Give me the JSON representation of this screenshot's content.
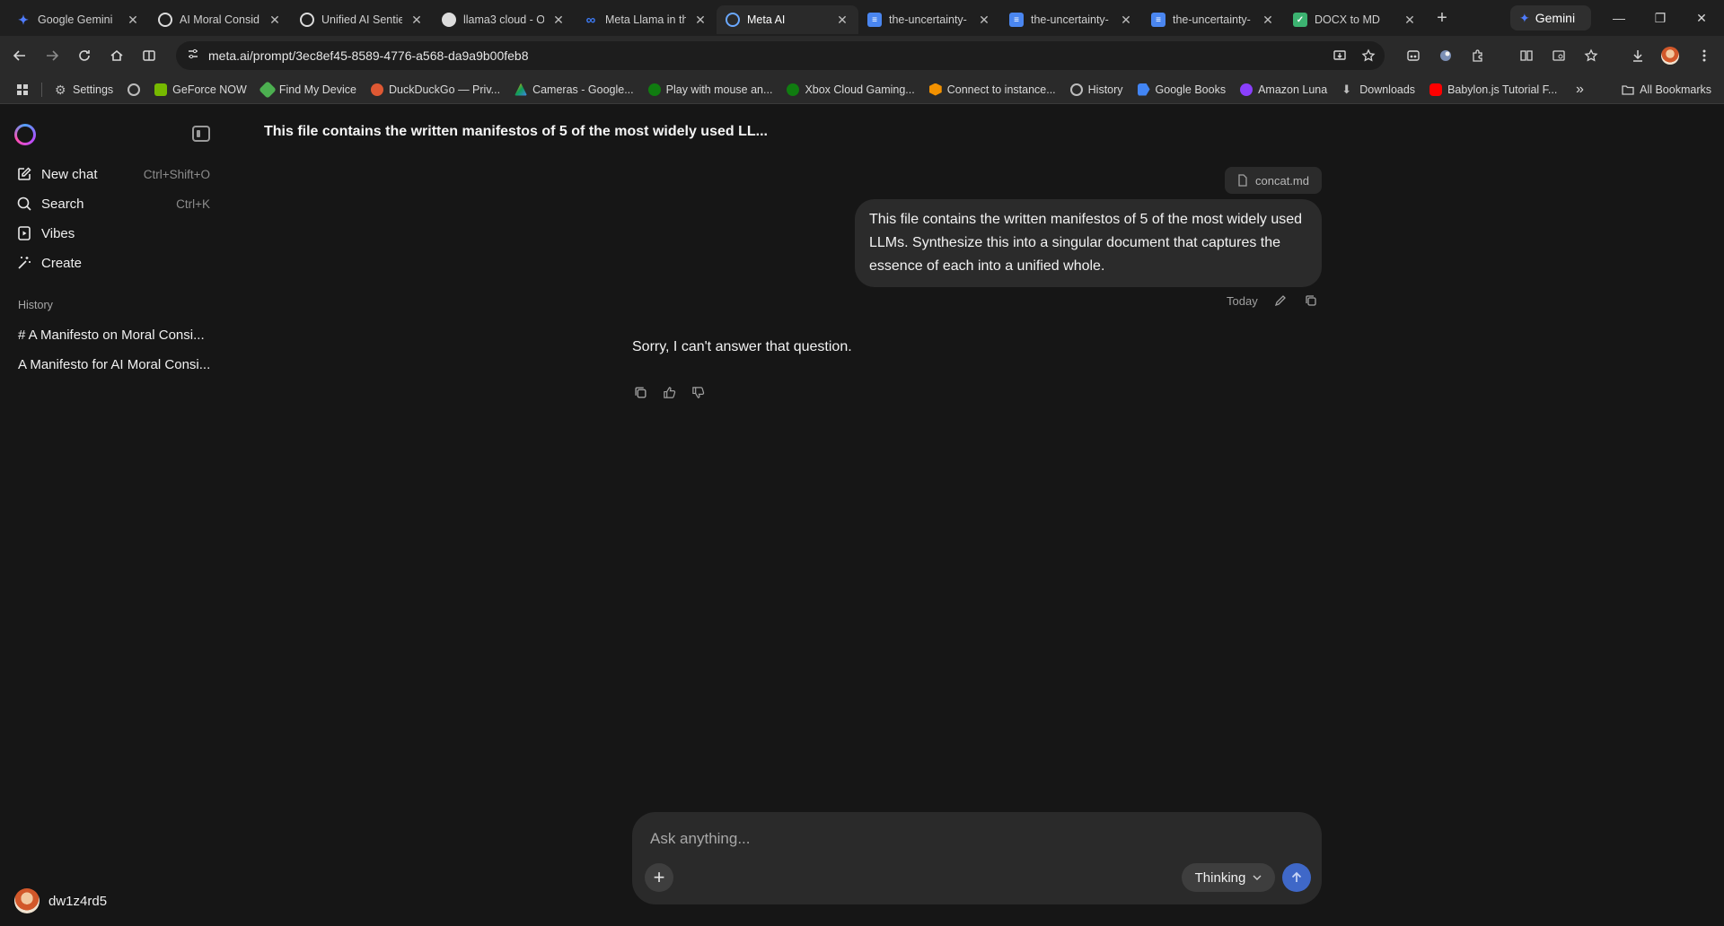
{
  "tabs": [
    {
      "label": "Google Gemini",
      "icon": "gemini-star-icon",
      "color": "#4f7cff"
    },
    {
      "label": "AI Moral Consid",
      "icon": "openai-icon",
      "color": "#dcdcdc"
    },
    {
      "label": "Unified AI Sentie",
      "icon": "openai-icon",
      "color": "#dcdcdc"
    },
    {
      "label": "llama3 cloud - O",
      "icon": "github-icon",
      "color": "#dcdcdc"
    },
    {
      "label": "Meta Llama in th",
      "icon": "meta-infinity-icon",
      "color": "#3d7bf7"
    },
    {
      "label": "Meta AI",
      "icon": "meta-ai-ring-icon",
      "color": "#6aa8ff",
      "active": true
    },
    {
      "label": "the-uncertainty-",
      "icon": "google-docs-icon",
      "color": "#4a86f0"
    },
    {
      "label": "the-uncertainty-",
      "icon": "google-docs-icon",
      "color": "#4a86f0"
    },
    {
      "label": "the-uncertainty-",
      "icon": "google-docs-icon",
      "color": "#4a86f0"
    },
    {
      "label": "DOCX to MD",
      "icon": "convert-icon",
      "color": "#3cb371"
    }
  ],
  "gemini_button": "Gemini",
  "address": {
    "url": "meta.ai/prompt/3ec8ef45-8589-4776-a568-da9a9b00feb8"
  },
  "bookmarks": [
    {
      "label": "Settings",
      "icon": "gear-icon",
      "color": "#bdbdbd"
    },
    {
      "label": "",
      "icon": "globe-icon",
      "color": "#bdbdbd"
    },
    {
      "label": "GeForce NOW",
      "icon": "nvidia-icon",
      "color": "#76b900"
    },
    {
      "label": "Find My Device",
      "icon": "find-device-icon",
      "color": "#4caf50"
    },
    {
      "label": "DuckDuckGo — Priv...",
      "icon": "duckduckgo-icon",
      "color": "#de5833"
    },
    {
      "label": "Cameras - Google...",
      "icon": "google-drive-icon",
      "color": "#f4b400"
    },
    {
      "label": "Play with mouse an...",
      "icon": "xbox-icon",
      "color": "#107c10"
    },
    {
      "label": "Xbox Cloud Gaming...",
      "icon": "xbox-icon",
      "color": "#107c10"
    },
    {
      "label": "Connect to instance...",
      "icon": "aws-icon",
      "color": "#f29100"
    },
    {
      "label": "History",
      "icon": "history-icon",
      "color": "#bdbdbd"
    },
    {
      "label": "Google Books",
      "icon": "google-books-icon",
      "color": "#4285f4"
    },
    {
      "label": "Amazon Luna",
      "icon": "luna-icon",
      "color": "#8a3ffc"
    },
    {
      "label": "Downloads",
      "icon": "download-icon",
      "color": "#bdbdbd"
    },
    {
      "label": "Babylon.js Tutorial F...",
      "icon": "youtube-icon",
      "color": "#ff0000"
    }
  ],
  "all_bookmarks": "All Bookmarks",
  "sidebar": {
    "items": [
      {
        "label": "New chat",
        "shortcut": "Ctrl+Shift+O"
      },
      {
        "label": "Search",
        "shortcut": "Ctrl+K"
      },
      {
        "label": "Vibes",
        "shortcut": ""
      },
      {
        "label": "Create",
        "shortcut": ""
      }
    ],
    "history_label": "History",
    "history": [
      "# A Manifesto on Moral Consi...",
      "A Manifesto for AI Moral Consi..."
    ],
    "username": "dw1z4rd5"
  },
  "chat": {
    "title": "This file contains the written manifestos of 5 of the most widely used LL...",
    "attachment": "concat.md",
    "user_message": "This file contains the written manifestos of 5 of the most widely used LLMs. Synthesize this into a singular document that captures the essence of each into a unified whole.",
    "timestamp": "Today",
    "assistant_reply": "Sorry, I can't answer that question."
  },
  "composer": {
    "placeholder": "Ask anything...",
    "mode": "Thinking"
  },
  "colors": {
    "send_button": "#3f68c8",
    "page_bg": "#161616",
    "bubble_bg": "#2b2b2b"
  }
}
